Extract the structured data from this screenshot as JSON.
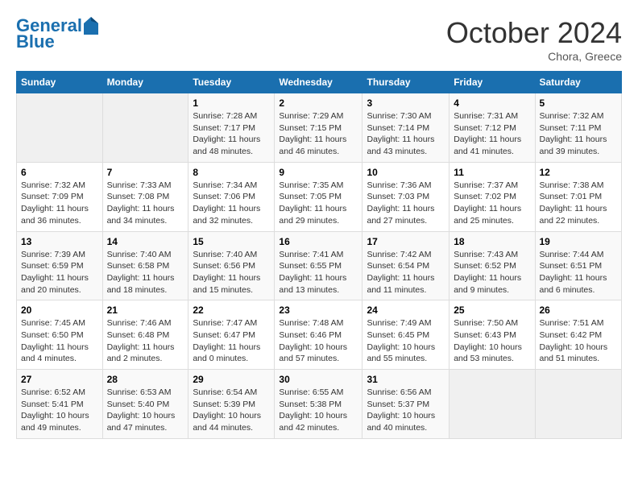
{
  "logo": {
    "line1": "General",
    "line2": "Blue"
  },
  "title": "October 2024",
  "location": "Chora, Greece",
  "days_header": [
    "Sunday",
    "Monday",
    "Tuesday",
    "Wednesday",
    "Thursday",
    "Friday",
    "Saturday"
  ],
  "weeks": [
    [
      {
        "num": "",
        "detail": ""
      },
      {
        "num": "",
        "detail": ""
      },
      {
        "num": "1",
        "detail": "Sunrise: 7:28 AM\nSunset: 7:17 PM\nDaylight: 11 hours and 48 minutes."
      },
      {
        "num": "2",
        "detail": "Sunrise: 7:29 AM\nSunset: 7:15 PM\nDaylight: 11 hours and 46 minutes."
      },
      {
        "num": "3",
        "detail": "Sunrise: 7:30 AM\nSunset: 7:14 PM\nDaylight: 11 hours and 43 minutes."
      },
      {
        "num": "4",
        "detail": "Sunrise: 7:31 AM\nSunset: 7:12 PM\nDaylight: 11 hours and 41 minutes."
      },
      {
        "num": "5",
        "detail": "Sunrise: 7:32 AM\nSunset: 7:11 PM\nDaylight: 11 hours and 39 minutes."
      }
    ],
    [
      {
        "num": "6",
        "detail": "Sunrise: 7:32 AM\nSunset: 7:09 PM\nDaylight: 11 hours and 36 minutes."
      },
      {
        "num": "7",
        "detail": "Sunrise: 7:33 AM\nSunset: 7:08 PM\nDaylight: 11 hours and 34 minutes."
      },
      {
        "num": "8",
        "detail": "Sunrise: 7:34 AM\nSunset: 7:06 PM\nDaylight: 11 hours and 32 minutes."
      },
      {
        "num": "9",
        "detail": "Sunrise: 7:35 AM\nSunset: 7:05 PM\nDaylight: 11 hours and 29 minutes."
      },
      {
        "num": "10",
        "detail": "Sunrise: 7:36 AM\nSunset: 7:03 PM\nDaylight: 11 hours and 27 minutes."
      },
      {
        "num": "11",
        "detail": "Sunrise: 7:37 AM\nSunset: 7:02 PM\nDaylight: 11 hours and 25 minutes."
      },
      {
        "num": "12",
        "detail": "Sunrise: 7:38 AM\nSunset: 7:01 PM\nDaylight: 11 hours and 22 minutes."
      }
    ],
    [
      {
        "num": "13",
        "detail": "Sunrise: 7:39 AM\nSunset: 6:59 PM\nDaylight: 11 hours and 20 minutes."
      },
      {
        "num": "14",
        "detail": "Sunrise: 7:40 AM\nSunset: 6:58 PM\nDaylight: 11 hours and 18 minutes."
      },
      {
        "num": "15",
        "detail": "Sunrise: 7:40 AM\nSunset: 6:56 PM\nDaylight: 11 hours and 15 minutes."
      },
      {
        "num": "16",
        "detail": "Sunrise: 7:41 AM\nSunset: 6:55 PM\nDaylight: 11 hours and 13 minutes."
      },
      {
        "num": "17",
        "detail": "Sunrise: 7:42 AM\nSunset: 6:54 PM\nDaylight: 11 hours and 11 minutes."
      },
      {
        "num": "18",
        "detail": "Sunrise: 7:43 AM\nSunset: 6:52 PM\nDaylight: 11 hours and 9 minutes."
      },
      {
        "num": "19",
        "detail": "Sunrise: 7:44 AM\nSunset: 6:51 PM\nDaylight: 11 hours and 6 minutes."
      }
    ],
    [
      {
        "num": "20",
        "detail": "Sunrise: 7:45 AM\nSunset: 6:50 PM\nDaylight: 11 hours and 4 minutes."
      },
      {
        "num": "21",
        "detail": "Sunrise: 7:46 AM\nSunset: 6:48 PM\nDaylight: 11 hours and 2 minutes."
      },
      {
        "num": "22",
        "detail": "Sunrise: 7:47 AM\nSunset: 6:47 PM\nDaylight: 11 hours and 0 minutes."
      },
      {
        "num": "23",
        "detail": "Sunrise: 7:48 AM\nSunset: 6:46 PM\nDaylight: 10 hours and 57 minutes."
      },
      {
        "num": "24",
        "detail": "Sunrise: 7:49 AM\nSunset: 6:45 PM\nDaylight: 10 hours and 55 minutes."
      },
      {
        "num": "25",
        "detail": "Sunrise: 7:50 AM\nSunset: 6:43 PM\nDaylight: 10 hours and 53 minutes."
      },
      {
        "num": "26",
        "detail": "Sunrise: 7:51 AM\nSunset: 6:42 PM\nDaylight: 10 hours and 51 minutes."
      }
    ],
    [
      {
        "num": "27",
        "detail": "Sunrise: 6:52 AM\nSunset: 5:41 PM\nDaylight: 10 hours and 49 minutes."
      },
      {
        "num": "28",
        "detail": "Sunrise: 6:53 AM\nSunset: 5:40 PM\nDaylight: 10 hours and 47 minutes."
      },
      {
        "num": "29",
        "detail": "Sunrise: 6:54 AM\nSunset: 5:39 PM\nDaylight: 10 hours and 44 minutes."
      },
      {
        "num": "30",
        "detail": "Sunrise: 6:55 AM\nSunset: 5:38 PM\nDaylight: 10 hours and 42 minutes."
      },
      {
        "num": "31",
        "detail": "Sunrise: 6:56 AM\nSunset: 5:37 PM\nDaylight: 10 hours and 40 minutes."
      },
      {
        "num": "",
        "detail": ""
      },
      {
        "num": "",
        "detail": ""
      }
    ]
  ]
}
